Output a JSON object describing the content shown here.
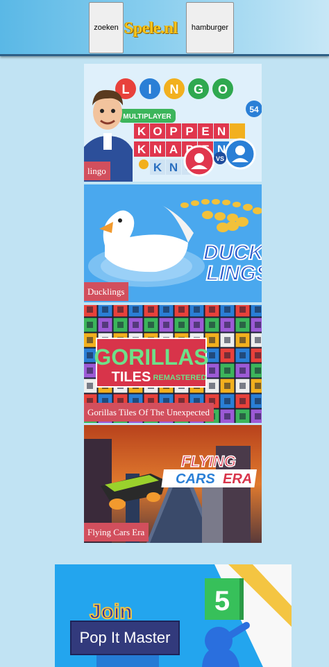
{
  "header": {
    "search_label": "zoeken",
    "logo_text": "Spele.nl",
    "menu_label": "hamburger"
  },
  "games": [
    {
      "title": "lingo",
      "art_text": "LINGO",
      "art_sub": "MULTIPLAYER",
      "art_words": [
        "KOPPEN",
        "KNAPEN",
        "KNO"
      ]
    },
    {
      "title": "Ducklings",
      "art_text": "DUCK",
      "art_sub": "LINGS"
    },
    {
      "title": "Gorillas Tiles Of The Unexpected",
      "art_text": "GORILLAS",
      "art_sub": "TILES REMASTERED"
    },
    {
      "title": "Flying Cars Era",
      "art_text": "FLYING",
      "art_sub": "CARS ERA"
    }
  ],
  "promo": {
    "title": "Pop It Master",
    "art_text": "Join",
    "art_number": "5"
  },
  "colors": {
    "background": "#c1e3f3",
    "label_bg": "#d24f5d",
    "logo": "#f6c51c"
  }
}
